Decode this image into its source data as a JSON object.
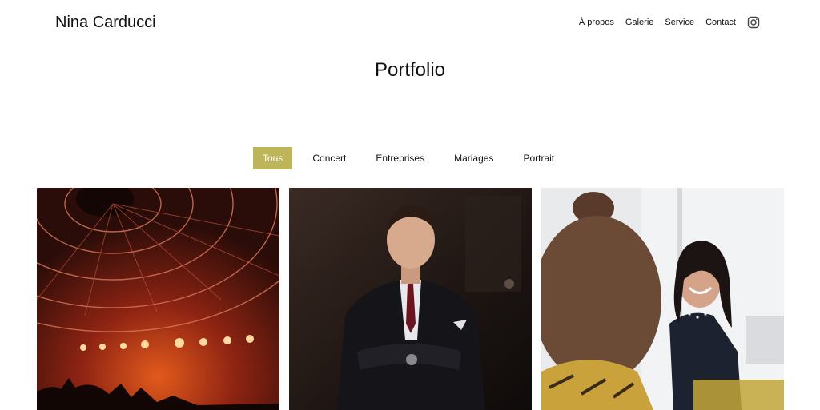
{
  "header": {
    "brand": "Nina Carducci",
    "nav": [
      "À propos",
      "Galerie",
      "Service",
      "Contact"
    ],
    "instagram_icon": "instagram-icon"
  },
  "main": {
    "title": "Portfolio"
  },
  "filters": {
    "items": [
      "Tous",
      "Concert",
      "Entreprises",
      "Mariages",
      "Portrait"
    ],
    "active_index": 0,
    "active_color": "#beb45a"
  },
  "gallery": {
    "images": [
      {
        "subject": "concert-stage-photo"
      },
      {
        "subject": "businessman-portrait-photo"
      },
      {
        "subject": "office-meeting-photo"
      }
    ]
  }
}
